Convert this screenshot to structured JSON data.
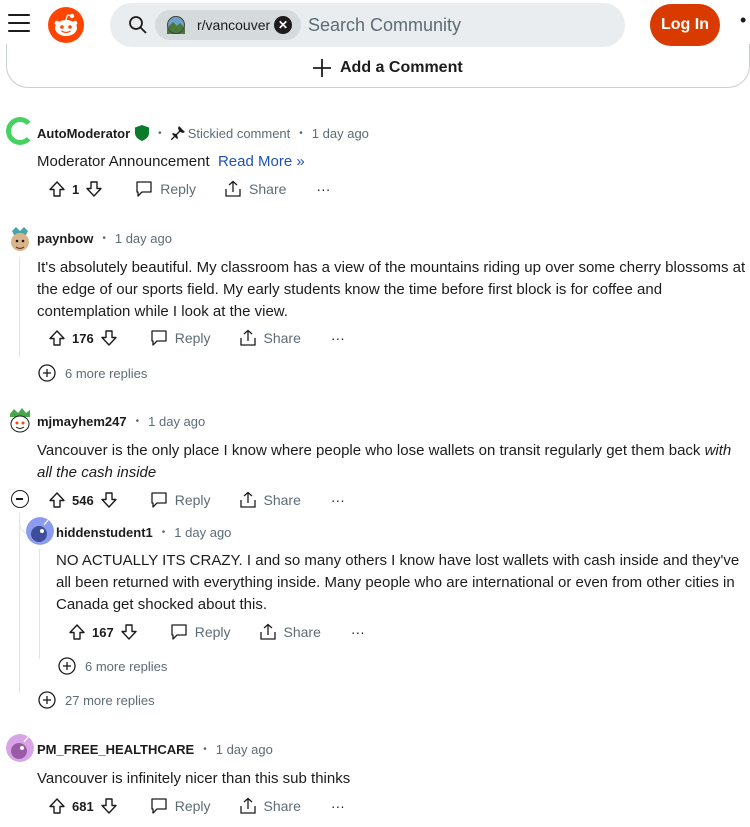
{
  "header": {
    "community": "r/vancouver",
    "search_placeholder": "Search Community",
    "login_label": "Log In",
    "more_label": "•",
    "chip_clear": "✕"
  },
  "add_comment_label": "Add a Comment",
  "comments": [
    {
      "username": "AutoModerator",
      "sticky_label": "Stickied comment",
      "time": "1 day ago",
      "body": "Moderator Announcement",
      "read_more": "Read More »",
      "votes": "1",
      "reply": "Reply",
      "share": "Share",
      "more": "···"
    },
    {
      "username": "paynbow",
      "time": "1 day ago",
      "body": "It's absolutely beautiful. My classroom has a view of the mountains riding up over some cherry blossoms at the edge of our sports field. My early students know the time before first block is for coffee and contemplation while I look at the view.",
      "votes": "176",
      "reply": "Reply",
      "share": "Share",
      "more": "···",
      "more_replies": "6 more replies"
    },
    {
      "username": "mjmayhem247",
      "time": "1 day ago",
      "body_plain": "Vancouver is the only place I know where people who lose wallets on transit regularly get them back ",
      "body_italic": "with all the cash inside",
      "votes": "546",
      "reply": "Reply",
      "share": "Share",
      "more": "···",
      "more_replies": "27 more replies",
      "reply_child": {
        "username": "hiddenstudent1",
        "time": "1 day ago",
        "body": "NO ACTUALLY ITS CRAZY. I and so many others I know have lost wallets with cash inside and they've all been returned with everything inside. Many people who are international or even from other cities in Canada get shocked about this.",
        "votes": "167",
        "reply": "Reply",
        "share": "Share",
        "more": "···",
        "more_replies": "6 more replies"
      }
    },
    {
      "username": "PM_FREE_HEALTHCARE",
      "time": "1 day ago",
      "body": "Vancouver is infinitely nicer than this sub thinks",
      "votes": "681",
      "reply": "Reply",
      "share": "Share",
      "more": "···"
    }
  ],
  "colors": {
    "brand": "#ff4500",
    "login_bg": "#d93a00",
    "meta_text": "#5c6c74",
    "link": "#1e53b5",
    "mod_shield": "#0b7a2a"
  }
}
